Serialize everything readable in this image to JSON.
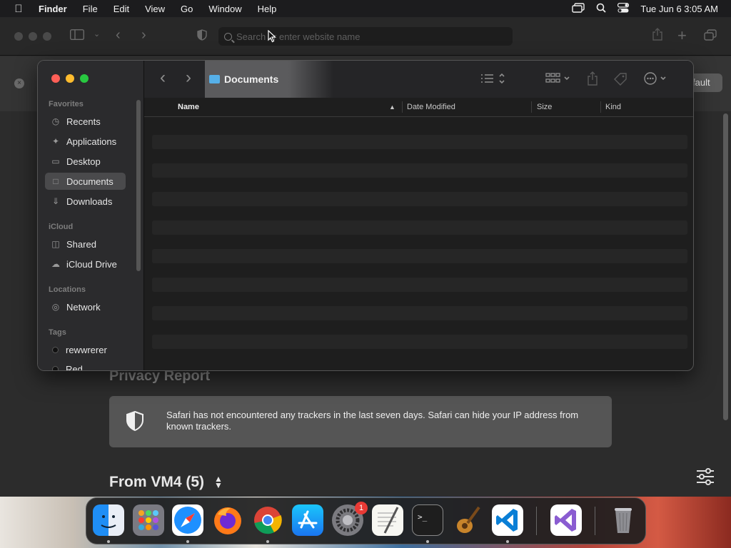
{
  "menubar": {
    "app_name": "Finder",
    "items": [
      "File",
      "Edit",
      "View",
      "Go",
      "Window",
      "Help"
    ],
    "datetime": "Tue Jun 6  3:05 AM"
  },
  "safari": {
    "address_placeholder": "Search or enter website name",
    "default_button": "fault",
    "privacy_title": "Privacy Report",
    "privacy_text": "Safari has not encountered any trackers in the last seven days. Safari can hide your IP address from known trackers.",
    "vm_title": "From VM4 (5)"
  },
  "finder": {
    "path_title": "Documents",
    "sidebar": {
      "favorites_label": "Favorites",
      "favorites": [
        {
          "label": "Recents",
          "icon": "clock-icon"
        },
        {
          "label": "Applications",
          "icon": "applications-icon"
        },
        {
          "label": "Desktop",
          "icon": "desktop-icon"
        },
        {
          "label": "Documents",
          "icon": "document-icon",
          "selected": true
        },
        {
          "label": "Downloads",
          "icon": "download-icon"
        }
      ],
      "icloud_label": "iCloud",
      "icloud": [
        {
          "label": "Shared",
          "icon": "shared-folder-icon"
        },
        {
          "label": "iCloud Drive",
          "icon": "cloud-icon"
        }
      ],
      "locations_label": "Locations",
      "locations": [
        {
          "label": "Network",
          "icon": "globe-icon"
        }
      ],
      "tags_label": "Tags",
      "tags": [
        {
          "label": "rewwrerer"
        },
        {
          "label": "Red"
        }
      ]
    },
    "columns": [
      "Name",
      "Date Modified",
      "Size",
      "Kind"
    ]
  },
  "dock": {
    "apps": [
      "Finder",
      "Launchpad",
      "Safari",
      "Firefox",
      "Chrome",
      "App Store",
      "System Settings",
      "TextEdit",
      "Terminal",
      "GarageBand",
      "Visual Studio Code",
      "Visual Studio",
      "Trash"
    ],
    "badge": "1"
  }
}
